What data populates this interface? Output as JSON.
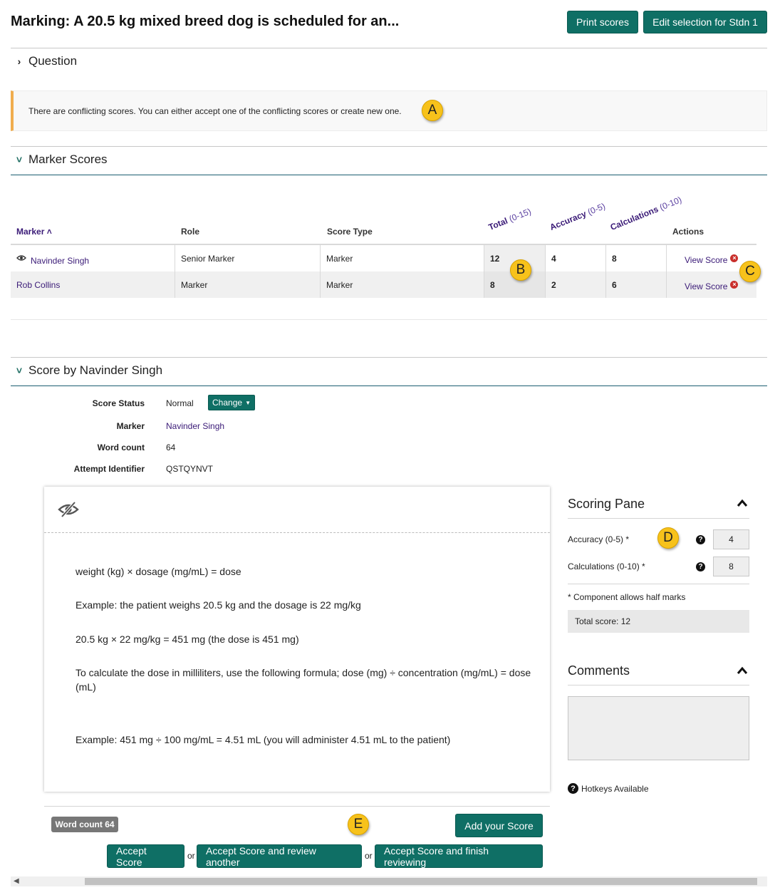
{
  "header": {
    "title": "Marking: A 20.5 kg mixed breed dog is scheduled for an...",
    "print_button": "Print scores",
    "edit_button": "Edit selection for Stdn 1"
  },
  "question_section": {
    "label": "Question"
  },
  "alert": {
    "text": "There are conflicting scores. You can either accept one of the conflicting scores or create new one."
  },
  "callouts": {
    "a": "A",
    "b": "B",
    "c": "C",
    "d": "D",
    "e": "E"
  },
  "marker_scores": {
    "title": "Marker Scores",
    "columns": {
      "marker": "Marker",
      "role": "Role",
      "score_type": "Score Type",
      "total": "Total",
      "total_range": "(0-15)",
      "accuracy": "Accuracy",
      "accuracy_range": "(0-5)",
      "calculations": "Calculations",
      "calculations_range": "(0-10)",
      "actions": "Actions"
    },
    "rows": [
      {
        "marker": "Navinder Singh",
        "role": "Senior Marker",
        "score_type": "Marker",
        "total": "12",
        "accuracy": "4",
        "calculations": "8",
        "action": "View Score"
      },
      {
        "marker": "Rob Collins",
        "role": "Marker",
        "score_type": "Marker",
        "total": "8",
        "accuracy": "2",
        "calculations": "6",
        "action": "View Score"
      }
    ]
  },
  "score_by": {
    "title": "Score by Navinder Singh",
    "status_label": "Score Status",
    "status_value": "Normal",
    "change_button": "Change",
    "marker_label": "Marker",
    "marker_value": "Navinder Singh",
    "word_count_label": "Word count",
    "word_count_value": "64",
    "attempt_label": "Attempt Identifier",
    "attempt_value": "QSTQYNVT"
  },
  "answer": {
    "lines": [
      "weight (kg) × dosage (mg/mL) = dose",
      "Example: the patient weighs 20.5 kg and the dosage is 22 mg/kg",
      "20.5 kg × 22 mg/kg = 451 mg (the dose is 451 mg)",
      "To calculate the dose in milliliters, use the following formula; dose (mg) ÷ concentration (mg/mL) = dose (mL)",
      "Example: 451 mg ÷ 100 mg/mL = 4.51 mL (you will administer 4.51 mL to the patient)"
    ]
  },
  "scoring_pane": {
    "title": "Scoring Pane",
    "accuracy_label": "Accuracy (0-5) *",
    "accuracy_value": "4",
    "calculations_label": "Calculations (0-10) *",
    "calculations_value": "8",
    "note": "* Component allows half marks",
    "total": "Total score: 12"
  },
  "comments": {
    "title": "Comments",
    "value": ""
  },
  "hotkeys": {
    "label": "Hotkeys Available"
  },
  "footer": {
    "word_count_badge": "Word count 64",
    "add_score": "Add your Score",
    "accept": "Accept Score",
    "or": "or",
    "accept_review": "Accept Score and review another",
    "accept_finish": "Accept Score and finish reviewing"
  }
}
